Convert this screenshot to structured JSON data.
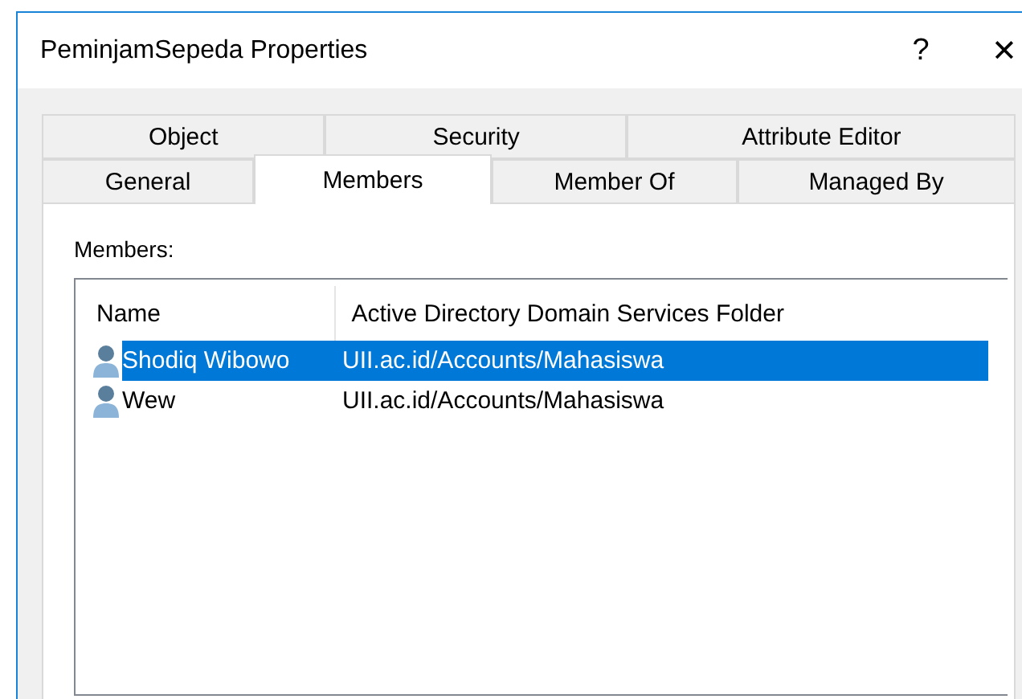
{
  "window": {
    "title": "PeminjamSepeda Properties",
    "help": "?",
    "close": "✕"
  },
  "tab_rows": [
    [
      {
        "label": "Object",
        "selected": false
      },
      {
        "label": "Security",
        "selected": false
      },
      {
        "label": "Attribute Editor",
        "selected": false
      }
    ],
    [
      {
        "label": "General",
        "selected": false
      },
      {
        "label": "Members",
        "selected": true
      },
      {
        "label": "Member Of",
        "selected": false
      },
      {
        "label": "Managed By",
        "selected": false
      }
    ]
  ],
  "members": {
    "label": "Members:",
    "columns": [
      "Name",
      "Active Directory Domain Services Folder"
    ],
    "rows": [
      {
        "name": "Shodiq Wibowo",
        "folder": "UII.ac.id/Accounts/Mahasiswa",
        "selected": true
      },
      {
        "name": "Wew",
        "folder": "UII.ac.id/Accounts/Mahasiswa",
        "selected": false
      }
    ]
  }
}
